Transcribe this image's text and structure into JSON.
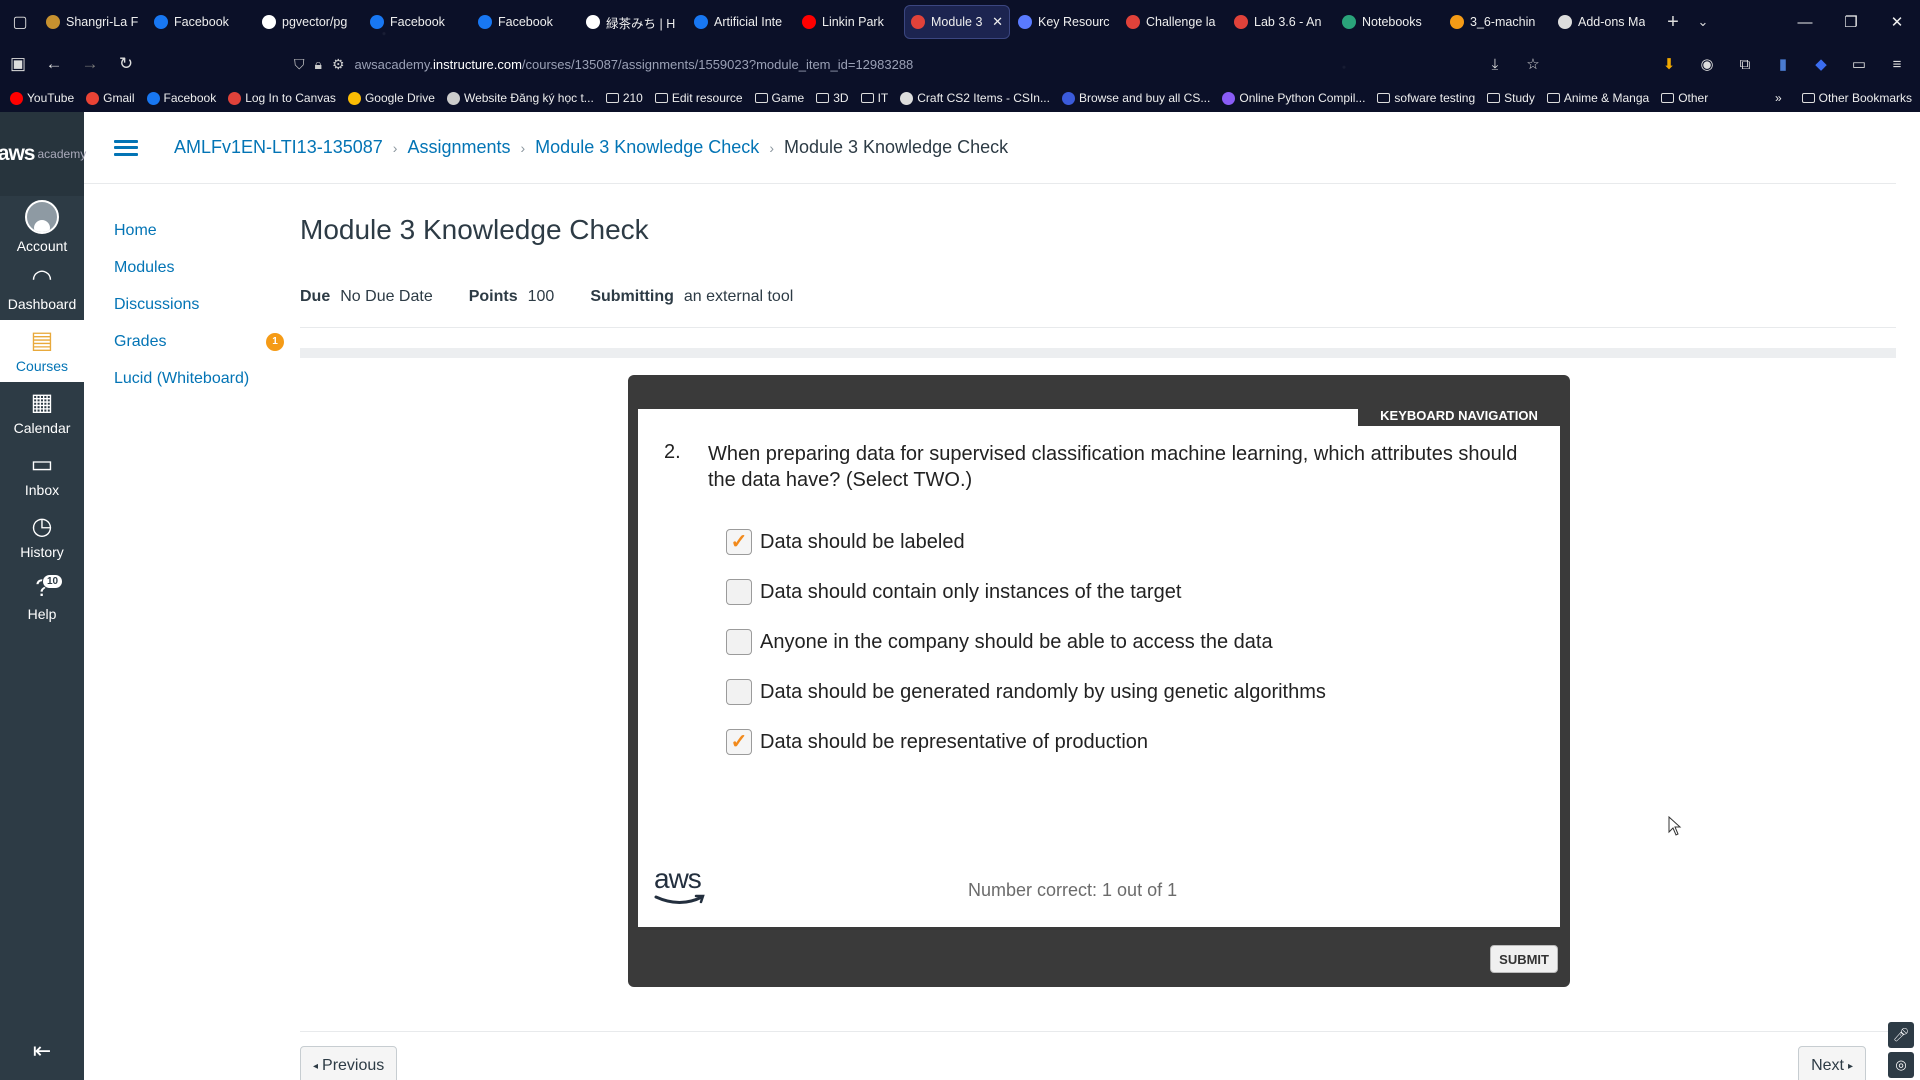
{
  "browser": {
    "tabs": [
      {
        "label": "Shangri-La F",
        "color": "#c7912f"
      },
      {
        "label": "Facebook",
        "color": "#1877f2"
      },
      {
        "label": "pgvector/pg",
        "color": "#ffffff"
      },
      {
        "label": "Facebook",
        "color": "#1877f2"
      },
      {
        "label": "Facebook",
        "color": "#1877f2"
      },
      {
        "label": "緑茶みち | H",
        "color": "#ffffff"
      },
      {
        "label": "Artificial Inte",
        "color": "#1877f2"
      },
      {
        "label": "Linkin Park",
        "color": "#ff0000"
      },
      {
        "label": "Module 3",
        "color": "#e0423a",
        "active": true
      },
      {
        "label": "Key Resourc",
        "color": "#5a7bff"
      },
      {
        "label": "Challenge la",
        "color": "#e0423a"
      },
      {
        "label": "Lab 3.6 - An",
        "color": "#e0423a"
      },
      {
        "label": "Notebooks",
        "color": "#2aa37a"
      },
      {
        "label": "3_6-machin",
        "color": "#f59b16"
      },
      {
        "label": "Add-ons Ma",
        "color": "#dddddd"
      }
    ],
    "url_prefix": "awsacademy.",
    "url_domain": "instructure.com",
    "url_path": "/courses/135087/assignments/1559023?module_item_id=12983288",
    "bookmarks": [
      {
        "label": "YouTube",
        "icon": "youtube-icon",
        "color": "#ff0000"
      },
      {
        "label": "Gmail",
        "icon": "google-icon",
        "color": "#ea4335"
      },
      {
        "label": "Facebook",
        "icon": "facebook-icon",
        "color": "#1877f2"
      },
      {
        "label": "Log In to Canvas",
        "icon": "canvas-icon",
        "color": "#e0423a"
      },
      {
        "label": "Google Drive",
        "icon": "drive-icon",
        "color": "#fbbc04"
      },
      {
        "label": "Website Đăng ký học t...",
        "icon": "globe-icon",
        "color": "#cccccc"
      },
      {
        "label": "210",
        "icon": "folder-icon"
      },
      {
        "label": "Edit resource",
        "icon": "folder-icon"
      },
      {
        "label": "Game",
        "icon": "folder-icon"
      },
      {
        "label": "3D",
        "icon": "folder-icon"
      },
      {
        "label": "IT",
        "icon": "folder-icon"
      },
      {
        "label": "Craft CS2 Items - CSIn...",
        "icon": "cs-icon",
        "color": "#dddddd"
      },
      {
        "label": "Browse and buy all CS...",
        "icon": "store-icon",
        "color": "#3b5bdb"
      },
      {
        "label": "Online Python Compil...",
        "icon": "python-icon",
        "color": "#8a5cf6"
      },
      {
        "label": "sofware testing",
        "icon": "folder-icon"
      },
      {
        "label": "Study",
        "icon": "folder-icon"
      },
      {
        "label": "Anime & Manga",
        "icon": "folder-icon"
      },
      {
        "label": "Other",
        "icon": "folder-icon"
      }
    ],
    "other_bookmarks": "Other Bookmarks"
  },
  "global_nav": {
    "logo_aws": "aws",
    "logo_academy": "academy",
    "items": [
      {
        "label": "Account",
        "icon": "account-icon"
      },
      {
        "label": "Dashboard",
        "icon": "dashboard-icon",
        "glyph": "◠"
      },
      {
        "label": "Courses",
        "icon": "courses-icon",
        "glyph": "▤",
        "active": true
      },
      {
        "label": "Calendar",
        "icon": "calendar-icon",
        "glyph": "▦"
      },
      {
        "label": "Inbox",
        "icon": "inbox-icon",
        "glyph": "▭"
      },
      {
        "label": "History",
        "icon": "history-icon",
        "glyph": "◷"
      },
      {
        "label": "Help",
        "icon": "help-icon",
        "glyph": "?",
        "badge": "10"
      }
    ]
  },
  "breadcrumb": {
    "course": "AMLFv1EN-LTI13-135087",
    "assignments": "Assignments",
    "module": "Module 3 Knowledge Check",
    "current": "Module 3 Knowledge Check"
  },
  "course_nav": {
    "items": [
      {
        "label": "Home"
      },
      {
        "label": "Modules"
      },
      {
        "label": "Discussions"
      },
      {
        "label": "Grades",
        "badge": "1"
      },
      {
        "label": "Lucid (Whiteboard)"
      }
    ]
  },
  "assignment": {
    "title": "Module 3 Knowledge Check",
    "due_label": "Due",
    "due_value": "No Due Date",
    "points_label": "Points",
    "points_value": "100",
    "submitting_label": "Submitting",
    "submitting_value": "an external tool"
  },
  "quiz": {
    "keyboard_nav": "KEYBOARD NAVIGATION",
    "question_number": "2.",
    "question_text": "When preparing data for supervised classification machine learning, which attributes should the data have? (Select TWO.)",
    "options": [
      {
        "label": "Data should be labeled",
        "checked": true
      },
      {
        "label": "Data should contain only instances of the target",
        "checked": false
      },
      {
        "label": "Anyone in the company should be able to access the data",
        "checked": false
      },
      {
        "label": "Data should be generated randomly by using genetic algorithms",
        "checked": false
      },
      {
        "label": "Data should be representative of production",
        "checked": true
      }
    ],
    "logo": "aws",
    "score": "Number correct: 1 out of 1",
    "submit": "SUBMIT"
  },
  "footer": {
    "previous": "Previous",
    "next": "Next"
  },
  "colors": {
    "link": "#0374b5",
    "nav_bg": "#2d3b45",
    "badge": "#f59b16",
    "check": "#f28a1c"
  }
}
